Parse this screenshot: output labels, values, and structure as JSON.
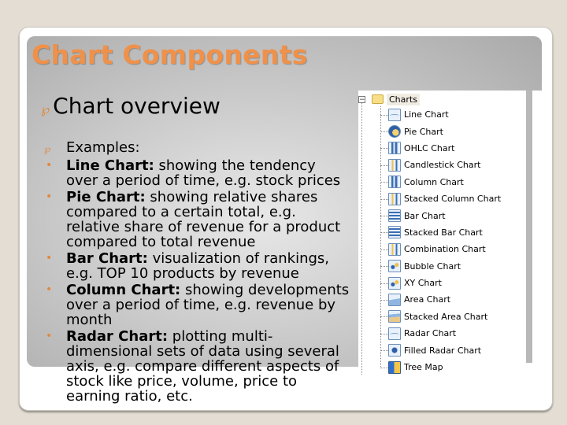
{
  "slide": {
    "title": "Chart Components",
    "heading": "Chart overview",
    "heading_bullet_icon": "curl-bullet-icon",
    "examples_label": "Examples:",
    "bullets": [
      {
        "term": "Line Chart:",
        "text": " showing the tendency over a period of time, e.g. stock prices"
      },
      {
        "term": "Pie Chart:",
        "text": " showing relative shares compared to a certain total, e.g. relative share of revenue for a product compared to total revenue"
      },
      {
        "term": "Bar Chart:",
        "text": " visualization of rankings, e.g. TOP 10 products by revenue"
      },
      {
        "term": "Column Chart:",
        "text": " showing developments over a period of time, e.g. revenue by month"
      },
      {
        "term": "Radar Chart:",
        "text": " plotting multi-dimensional sets of data using several axis, e.g. compare different aspects of stock like price, volume, price to earning ratio, etc."
      }
    ],
    "bullet_glyph": "•",
    "curl_glyph": "℘"
  },
  "tree": {
    "expander_glyph": "−",
    "root_label": "Charts",
    "root_icon": "folder-icon",
    "items": [
      {
        "label": "Line Chart",
        "icon": "line-chart-icon"
      },
      {
        "label": "Pie Chart",
        "icon": "pie-chart-icon"
      },
      {
        "label": "OHLC Chart",
        "icon": "ohlc-chart-icon"
      },
      {
        "label": "Candlestick Chart",
        "icon": "candlestick-chart-icon"
      },
      {
        "label": "Column Chart",
        "icon": "column-chart-icon"
      },
      {
        "label": "Stacked Column Chart",
        "icon": "stacked-column-chart-icon"
      },
      {
        "label": "Bar Chart",
        "icon": "bar-chart-icon"
      },
      {
        "label": "Stacked Bar Chart",
        "icon": "stacked-bar-chart-icon"
      },
      {
        "label": "Combination Chart",
        "icon": "combination-chart-icon"
      },
      {
        "label": "Bubble Chart",
        "icon": "bubble-chart-icon"
      },
      {
        "label": "XY Chart",
        "icon": "xy-chart-icon"
      },
      {
        "label": "Area Chart",
        "icon": "area-chart-icon"
      },
      {
        "label": "Stacked Area Chart",
        "icon": "stacked-area-chart-icon"
      },
      {
        "label": "Radar Chart",
        "icon": "radar-chart-icon"
      },
      {
        "label": "Filled Radar Chart",
        "icon": "filled-radar-chart-icon"
      },
      {
        "label": "Tree Map",
        "icon": "tree-map-icon"
      }
    ]
  },
  "colors": {
    "title": "#f0914a",
    "accent_bullet": "#e0893f",
    "background": "#e3ddd3"
  }
}
